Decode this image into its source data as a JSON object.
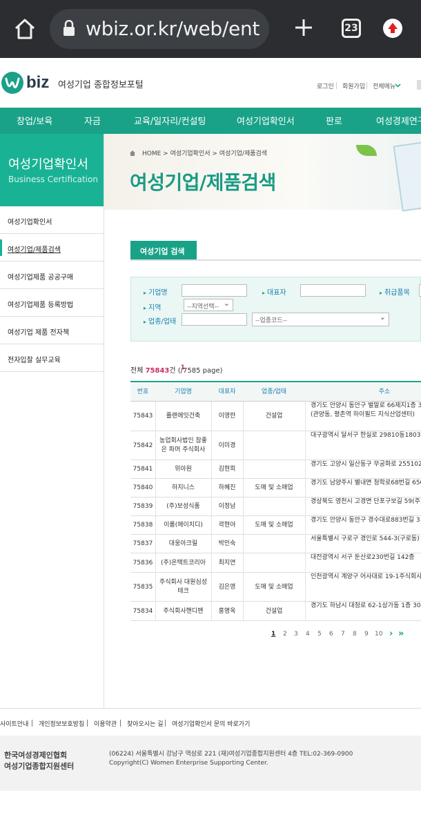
{
  "browser": {
    "url": "wbiz.or.kr/web/ent",
    "tab_count": "23"
  },
  "header": {
    "logo_text": "biz",
    "logo_sub": "여성기업 종합정보포털",
    "util": [
      "로그인",
      "회원가입",
      "전체메뉴"
    ]
  },
  "gnb": [
    "창업/보육",
    "자금",
    "교육/일자리/컨설팅",
    "여성기업확인서",
    "판로",
    "여성경제연구"
  ],
  "lnb": {
    "title": "여성기업확인서",
    "subtitle": "Business Certification",
    "items": [
      {
        "label": "여성기업확인서",
        "active": false
      },
      {
        "label": "여성기업/제품검색",
        "active": true
      },
      {
        "label": "여성기업제품 공공구매",
        "active": false
      },
      {
        "label": "여성기업제품 등록방법",
        "active": false
      },
      {
        "label": "여성기업 제품 전자책",
        "active": false
      },
      {
        "label": "전자입찰 실무교육",
        "active": false
      }
    ]
  },
  "content": {
    "breadcrumb": "HOME > 여성기업확인서 > 여성기업/제품검색",
    "title": "여성기업/제품검색",
    "tab_label": "여성기업 검색"
  },
  "search": {
    "company_label": "기업명",
    "ceo_label": "대표자",
    "item_label": "취급품목",
    "region_label": "지역",
    "region_value": "--지역선택--",
    "industry_label": "업종/업태",
    "industry_code_value": "--업종코드--"
  },
  "results": {
    "total_prefix": "전체 ",
    "total_count": "75843",
    "total_mid": "건 (",
    "page_current": "1",
    "page_rest": "/7585 page)"
  },
  "table": {
    "headers": [
      "번호",
      "기업명",
      "대표자",
      "업종/업태",
      "주소"
    ],
    "rows": [
      {
        "no": "75843",
        "name": "플랜에잇건축",
        "ceo": "이영란",
        "industry": "건설업",
        "addr1": "경기도 안양시 동안구 벌말로 66제지1층 3",
        "addr2": "(관양동, 평촌역 하이필드 지식산업센터)"
      },
      {
        "no": "75842",
        "name": "농업회사법인 참좋은 파머 주식회사",
        "ceo": "이미경",
        "industry": "",
        "addr1": "대구광역시 달서구 한실로 29810동1803호",
        "addr2": ""
      },
      {
        "no": "75841",
        "name": "위아원",
        "ceo": "김현희",
        "industry": "",
        "addr1": "경기도 고양시 일산동구 무궁화로 255102",
        "addr2": ""
      },
      {
        "no": "75840",
        "name": "하지니스",
        "ceo": "하혜진",
        "industry": "도매 및 소매업",
        "addr1": "경기도 남양주시 별내면 청학로68번길 650",
        "addr2": ""
      },
      {
        "no": "75839",
        "name": "(주)보성식품",
        "ceo": "이정남",
        "industry": "",
        "addr1": "경상북도 영천시 고경면 단포구보길 59(주)",
        "addr2": ""
      },
      {
        "no": "75838",
        "name": "이룸(에이치디)",
        "ceo": "곽현아",
        "industry": "도매 및 소매업",
        "addr1": "경기도 안양시 동안구 경수대로883번길 3",
        "addr2": ""
      },
      {
        "no": "75837",
        "name": "대웅아크릴",
        "ceo": "박민숙",
        "industry": "",
        "addr1": "서울특별시 구로구 경인로 544-3(구로동)",
        "addr2": ""
      },
      {
        "no": "75836",
        "name": "(주)온택트코리아",
        "ceo": "최지연",
        "industry": "",
        "addr1": "대전광역시 서구 둔산로230번길 142층",
        "addr2": ""
      },
      {
        "no": "75835",
        "name": "주식회사 대원심성테크",
        "ceo": "김은영",
        "industry": "도매 및 소매업",
        "addr1": "인천광역시 계양구 어사대로 19-1주식회사",
        "addr2": ""
      },
      {
        "no": "75834",
        "name": "주식회사핸디맨",
        "ceo": "홍명옥",
        "industry": "건설업",
        "addr1": "경기도 하남시 대청로 62-1상가동 1층 303",
        "addr2": ""
      }
    ]
  },
  "pagination": [
    "1",
    "2",
    "3",
    "4",
    "5",
    "6",
    "7",
    "8",
    "9",
    "10"
  ],
  "footer": {
    "links": [
      "사이트안내",
      "개인정보보호방침",
      "이용약관",
      "찾아오시는 길",
      "여성기업확인서 문의 바로가기"
    ],
    "org1": "한국여성경제인협회",
    "org2": "여성기업종합지원센터",
    "address": "(06224) 서울특별시 강남구 역삼로 221 (재)여성기업종합지원센터 4층   TEL:02-369-0900",
    "copyright": "Copyright(C) Women Enterprise Supporting Center."
  },
  "colors": {
    "brand": "#1aa288",
    "accent": "#d02a60",
    "link_blue": "#1a7fb0"
  }
}
